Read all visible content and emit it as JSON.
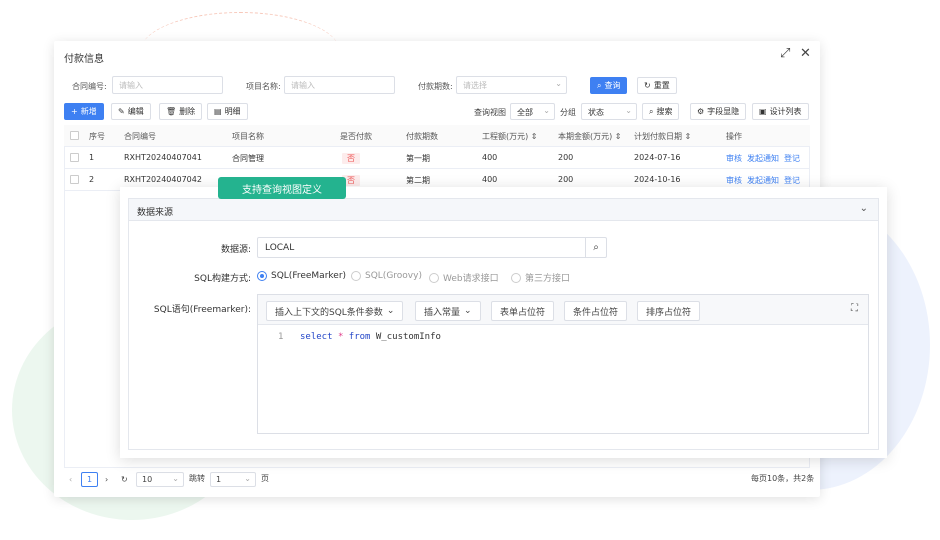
{
  "window": {
    "title": "付款信息",
    "expand_icon": "expand-icon",
    "close_icon": "close-icon"
  },
  "filters": {
    "contract_no": {
      "label": "合同编号:",
      "placeholder": "请输入"
    },
    "project_name": {
      "label": "项目名称:",
      "placeholder": "请输入"
    },
    "payment_period": {
      "label": "付款期数:",
      "placeholder": "请选择"
    },
    "query_label": "查询",
    "reset_label": "重置"
  },
  "toolbar": {
    "add_label": "新增",
    "edit_label": "编辑",
    "delete_label": "删除",
    "detail_label": "明细",
    "query_view_label": "查询视图",
    "query_view_value": "全部",
    "group_label": "分组",
    "group_value": "状态",
    "search_label": "搜索",
    "field_hide_label": "字段显隐",
    "design_list_label": "设计列表"
  },
  "table": {
    "columns": [
      "序号",
      "合同编号",
      "项目名称",
      "是否付款",
      "付款期数",
      "工程额(万元)",
      "本期金额(万元)",
      "计划付款日期",
      "操作"
    ],
    "sort_icon": "sort-icon",
    "rows": [
      {
        "no": "1",
        "contract_no": "RXHT20240407041",
        "project": "合同管理",
        "paid": "否",
        "period": "第一期",
        "amount": "400",
        "current": "200",
        "date": "2024-07-16"
      },
      {
        "no": "2",
        "contract_no": "RXHT20240407042",
        "project": "",
        "paid": "否",
        "period": "第二期",
        "amount": "400",
        "current": "200",
        "date": "2024-10-16"
      }
    ],
    "actions": [
      "审核",
      "发起通知",
      "登记"
    ]
  },
  "pager": {
    "current_page": "1",
    "page_size": "10",
    "jump_label": "跳转",
    "jump_value": "1",
    "page_unit": "页",
    "summary": "每页10条，共2条"
  },
  "overlay_tag": "支持查询视图定义",
  "panel": {
    "title": "数据来源",
    "datasource_label": "数据源:",
    "datasource_value": "LOCAL",
    "sql_mode_label": "SQL构建方式:",
    "sql_modes": [
      "SQL(FreeMarker)",
      "SQL(Groovy)",
      "Web请求接口",
      "第三方接口"
    ],
    "sql_mode_selected": "SQL(FreeMarker)",
    "sql_label": "SQL语句(Freemarker):",
    "editor_buttons": [
      "插入上下文的SQL条件参数",
      "插入常量",
      "表单占位符",
      "条件占位符",
      "排序占位符"
    ],
    "code_line_no": "1",
    "code": {
      "kw1": "select",
      "op": "*",
      "kw2": "from",
      "rest": "W_customInfo"
    }
  },
  "colors": {
    "primary": "#3e80f2",
    "tag_green": "#24b38f",
    "danger": "#e55555"
  }
}
